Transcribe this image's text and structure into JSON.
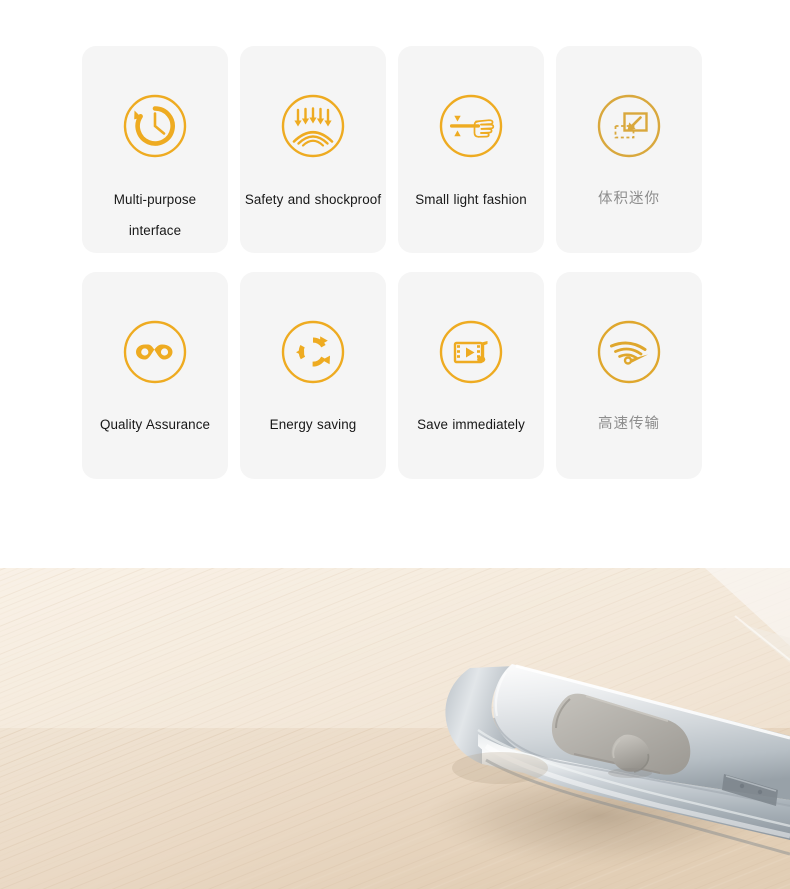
{
  "page": {
    "background_color": "#ffffff",
    "accent_color": "#eeab21",
    "card_background": "#f5f5f5",
    "label_color": "#181818",
    "label_color_cn": "#8d8d8d"
  },
  "features": {
    "row1": [
      {
        "id": "multi-purpose-interface",
        "icon": "clock-history-icon",
        "label_line1": "Multi-purpose",
        "label_line2": "interface",
        "language": "en"
      },
      {
        "id": "safety-and-shockproof",
        "icon": "shock-absorb-arrows-icon",
        "label_line1": "Safety and shockproof",
        "label_line2": "",
        "language": "en"
      },
      {
        "id": "small-light-fashion",
        "icon": "hand-thinness-measure-icon",
        "label_line1": "Small light fashion",
        "label_line2": "",
        "language": "en"
      },
      {
        "id": "mini-volume",
        "icon": "shrink-arrow-square-icon",
        "label_line1": "体积迷你",
        "label_line2": "",
        "language": "zh"
      }
    ],
    "row2": [
      {
        "id": "quality-assurance",
        "icon": "infinity-icon",
        "label_line1": "Quality Assurance",
        "label_line2": "",
        "language": "en"
      },
      {
        "id": "energy-saving",
        "icon": "recycle-arrows-icon",
        "label_line1": "Energy saving",
        "label_line2": "",
        "language": "en"
      },
      {
        "id": "save-immediately",
        "icon": "film-strip-music-note-icon",
        "label_line1": "Save immediately",
        "label_line2": "",
        "language": "en"
      },
      {
        "id": "high-speed-transfer",
        "icon": "speedometer-icon",
        "label_line1": "高速传输",
        "label_line2": "",
        "language": "zh"
      }
    ]
  },
  "product_photo": {
    "subject": "silver aluminium usb flash drive with gray sliding switch",
    "surface": "light wood table",
    "colors": {
      "wood_light": "#f3e9dc",
      "wood_mid": "#e7d8c4",
      "wood_dark": "#d9c5ab",
      "metal_light": "#f2f3f4",
      "metal_mid": "#c9ced2",
      "metal_dark": "#9aa1a7",
      "switch_gray": "#b8b5b0"
    }
  }
}
